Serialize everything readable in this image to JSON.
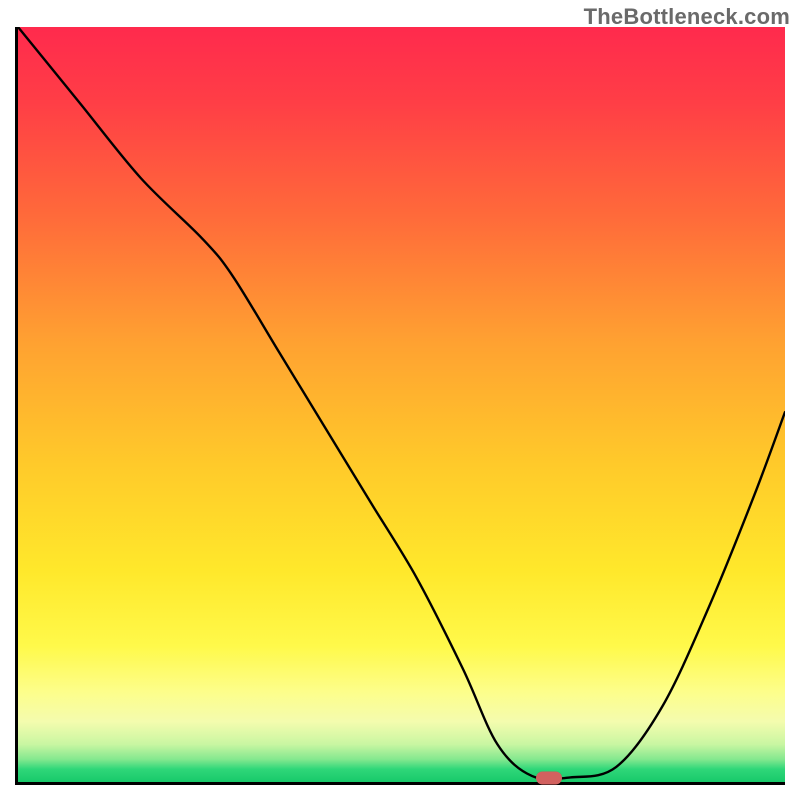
{
  "watermark": {
    "text": "TheBottleneck.com"
  },
  "chart_data": {
    "type": "line",
    "title": "",
    "xlabel": "",
    "ylabel": "",
    "xlim": [
      0,
      100
    ],
    "ylim": [
      0,
      100
    ],
    "grid": false,
    "legend": false,
    "background_gradient": [
      "#ff2a4d",
      "#ff6a3a",
      "#ffca2a",
      "#fff94a",
      "#2fd779"
    ],
    "series": [
      {
        "name": "bottleneck-curve",
        "x": [
          0,
          8,
          16,
          24,
          28,
          34,
          40,
          46,
          52,
          58,
          62.5,
          67,
          72,
          78,
          84,
          90,
          96,
          100
        ],
        "y": [
          100,
          90,
          80,
          72,
          67,
          57,
          47,
          37,
          27,
          15,
          5,
          0.8,
          0.6,
          2,
          10,
          23,
          38,
          49
        ]
      }
    ],
    "marker": {
      "x": 69,
      "y": 0.9,
      "kind": "optimal-point"
    }
  },
  "colors": {
    "axis": "#000000",
    "curve": "#000000",
    "marker": "#d2615f"
  }
}
